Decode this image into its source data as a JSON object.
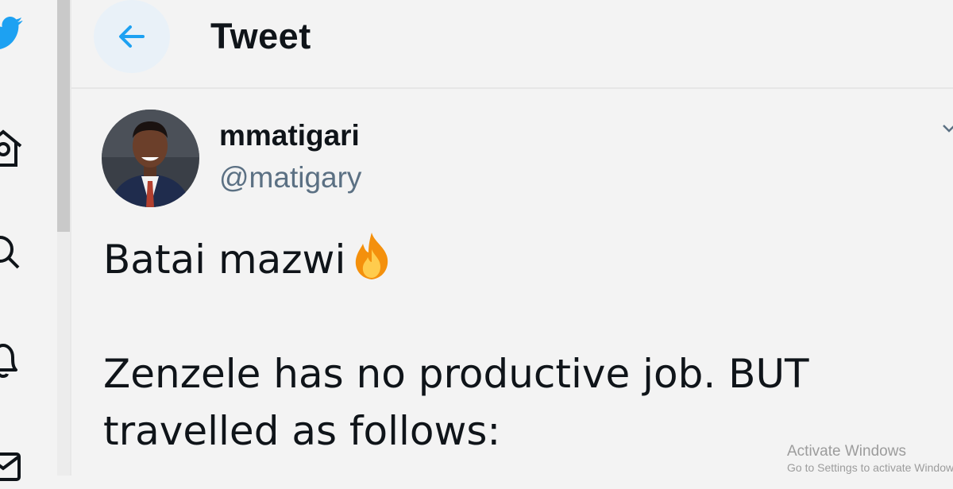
{
  "header": {
    "title": "Tweet"
  },
  "nav": {
    "icons": [
      "twitter-bird-icon",
      "home-icon",
      "search-icon",
      "bell-icon",
      "mail-icon"
    ]
  },
  "tweet": {
    "display_name": "mmatigari",
    "handle": "@matigary",
    "lines": [
      "Batai mazwi",
      "",
      "Zenzele has no productive job. BUT",
      "travelled as follows:"
    ],
    "emoji": "fire-icon"
  },
  "watermark": {
    "title": "Activate Windows",
    "subtitle": "Go to Settings to activate Windows."
  },
  "colors": {
    "accent": "#1da1f2",
    "text": "#0f1419",
    "muted": "#5b7083",
    "background": "#f3f3f3"
  }
}
